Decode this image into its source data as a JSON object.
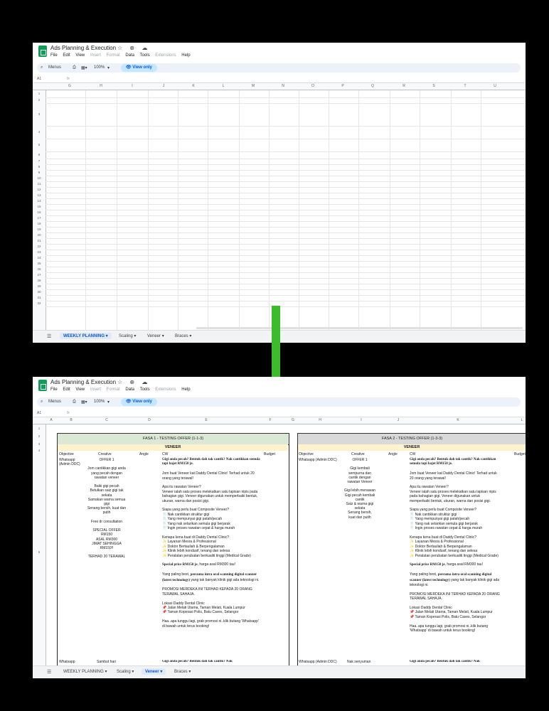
{
  "window1": {
    "title": "Ads Planning & Execution",
    "title_icons": "☆ ⊕ ☁",
    "menus": [
      "File",
      "Edit",
      "View",
      "Insert",
      "Format",
      "Data",
      "Tools",
      "Extensions",
      "Help"
    ],
    "disabled_menus": [
      "Insert",
      "Format",
      "Extensions"
    ],
    "toolbar": {
      "menus_label": "Menus",
      "zoom": "100%",
      "view_only": "View only"
    },
    "cell_ref": "A1",
    "fx": "fx",
    "columns": [
      "G",
      "H",
      "I",
      "J",
      "K",
      "L",
      "M",
      "N",
      "O",
      "P",
      "Q",
      "R",
      "S",
      "T",
      "U"
    ],
    "rows": [
      "1",
      "2",
      "3",
      "4",
      "5",
      "6",
      "7",
      "8",
      "9",
      "10",
      "11",
      "12",
      "13",
      "14",
      "15",
      "16",
      "17",
      "18",
      "19",
      "20",
      "21",
      "22",
      "23",
      "24",
      "25",
      "26",
      "27",
      "28",
      "29",
      "30",
      "31",
      "32"
    ],
    "tabs": [
      "WEEKLY PLANNING",
      "Scaling",
      "Veneer",
      "Braces"
    ],
    "active_tab": "WEEKLY PLANNING"
  },
  "window2": {
    "title": "Ads Planning & Execution",
    "title_icons": "☆ ⊕ ☁",
    "menus": [
      "File",
      "Edit",
      "View",
      "Insert",
      "Format",
      "Data",
      "Tools",
      "Extensions",
      "Help"
    ],
    "toolbar": {
      "menus_label": "Menus",
      "zoom": "100%",
      "view_only": "View only"
    },
    "cell_ref": "A1",
    "fx": "fx",
    "columns": [
      "A",
      "B",
      "C",
      "D",
      "E",
      "F",
      "G",
      "H",
      "I",
      "J",
      "K",
      "L"
    ],
    "rows": [
      "1",
      "2",
      "3",
      "4",
      "5"
    ],
    "tabs": [
      "WEEKLY PLANNING",
      "Scaling",
      "Veneer",
      "Braces"
    ],
    "active_tab": "Veneer",
    "phase1": {
      "title": "FASA 1 - TESTING OFFER (1-1-3)",
      "subtitle": "VENEER",
      "headers": [
        "Objective",
        "Creative",
        "Angle",
        "CW",
        "Budget"
      ],
      "objective": "Whatsapp (Admin DDC)",
      "creative": "OFFER 1\n\nJom cantikkan gigi anda yang pecah dengan rawatan veneer\n\nBaiki gigi pecah\nBetulkan saiz gigi tak sekata\nSamakan warna semua gigi\nSenang bersih, kuat dan putih\n\nFree dr consultation\n\nSPECIAL OFFER RM150\nASAL RM300\nJIMAT SEHINGGA RM150!!\n\nTERHAD 20 TERAWAL",
      "next_objective": "Whatsapp",
      "next_creative": "Sambut hari"
    },
    "phase2": {
      "title": "FASA 2 - TESTING OFFER (1-3-3)",
      "subtitle": "VENEER",
      "headers": [
        "Objective",
        "Creative",
        "Angle",
        "CW",
        "Budget"
      ],
      "objective": "Whatsapp (Admin DDC)",
      "creative": "OFFER 1\n\nGigi kembali sempurna dan cantik dengan rawatan Veneer\n\nGigi lebih menawan\nGigi pecah kembali cantik\nSaiz & warna gigi sekata\nSenang bersih, kuat dan putih",
      "next_objective": "Whatsapp (Admin DDC)",
      "next_creative": "Nak senyuman"
    },
    "cw": {
      "headline": "Gigi anda pecah? Bentuk dah tak cantik? Nak cantikkan semula tapi bajet RM150 je.",
      "p1": "Jom buat Veneer kat Daddy Dental Clinic! Terhad untuk 20 orang yang terawal!",
      "p2": "Apa itu rawatan Veneer?\nVeneer ialah satu proses melekatkan satu lapisan nipis pada bahagian gigi. Veneer digunakan untuk memperbaiki bentuk, ukuran, warna dan posisi gigi.",
      "p3": "Siapa yang perlu buat Composite Veneer?\n🦷 Nak cantikkan struktur gigi\n🦷 Yang mempunyai gigi patah/pecah\n🦷 Yang nak selarikan semula gigi berjarak\n🦷 Ingin proses rawatan cepat & harga murah",
      "p4": "Kenapa kena buat di Daddy Dental Clinic?\n✨ Layanan Mesra & Professional\n✨ Doktor Bertauliah & Berpengalaman\n✨ Klinik lebih kondusif, tenang dan selesa\n✨ Peralatan perubatan berkualiti tinggi (Medical Grade)",
      "p5_bold": "Special price RM150 je",
      "p5_rest": ", harga asal RM300 tau!",
      "p6_a": "Yang paling best, ",
      "p6_bold": "percuma intra oral scanning digital scanner (latest technology)",
      "p6_b": " yang tak banyak klinik gigi ada teknologi ni.",
      "p7": "PROMOSI MERDEKA INI TERHAD KEPADA 20 ORANG TERAWAL SAHAJA.",
      "p8": "Lokasi Daddy Dental Clinic\n📌 Jalan Melati Utama, Taman Melati, Kuala Lumpur\n📌 Taman Koperasi Polis, Batu Caves, Selangor",
      "p9": "Haa..apa tunggu lagi, grab promosi ni..klik butang 'Whatsapp' di bawah untuk terus booking!",
      "next_headline": "Gigi anda pecah? Bentuk dah tak cantik? Nak"
    }
  }
}
